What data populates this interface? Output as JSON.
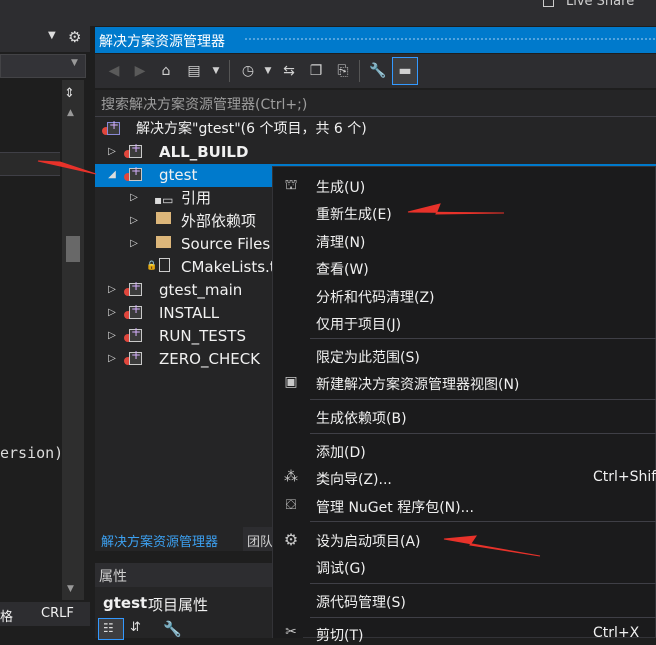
{
  "top": {
    "live_share": "Live Share"
  },
  "left": {
    "code_fragment": "ersion)",
    "status_left": "格",
    "status_crlf": "CRLF"
  },
  "solution_explorer": {
    "title": "解决方案资源管理器",
    "search_placeholder": "搜索解决方案资源管理器(Ctrl+;)",
    "tree": [
      {
        "id": "solution",
        "label": "解决方案\"gtest\"(6 个项目，共 6 个)"
      },
      {
        "id": "all_build",
        "label": "ALL_BUILD"
      },
      {
        "id": "gtest",
        "label": "gtest"
      },
      {
        "id": "references",
        "label": "引用"
      },
      {
        "id": "external_deps",
        "label": "外部依赖项"
      },
      {
        "id": "source_files",
        "label": "Source Files"
      },
      {
        "id": "cmakelists",
        "label": "CMakeLists.t"
      },
      {
        "id": "gtest_main",
        "label": "gtest_main"
      },
      {
        "id": "install",
        "label": "INSTALL"
      },
      {
        "id": "run_tests",
        "label": "RUN_TESTS"
      },
      {
        "id": "zero_check",
        "label": "ZERO_CHECK"
      }
    ],
    "tabs": {
      "active": "解决方案资源管理器",
      "other": "团队"
    }
  },
  "properties": {
    "title": "属性",
    "object_name": "gtest",
    "object_type": "项目属性"
  },
  "context_menu": {
    "items": [
      {
        "id": "build",
        "label": "生成(U)",
        "icon": "build-icon"
      },
      {
        "id": "rebuild",
        "label": "重新生成(E)"
      },
      {
        "id": "clean",
        "label": "清理(N)"
      },
      {
        "id": "view",
        "label": "查看(W)"
      },
      {
        "id": "analyze",
        "label": "分析和代码清理(Z)"
      },
      {
        "id": "project_only",
        "label": "仅用于项目(J)"
      },
      {
        "id": "scope_to_this",
        "label": "限定为此范围(S)"
      },
      {
        "id": "new_se_view",
        "label": "新建解决方案资源管理器视图(N)",
        "icon": "new-view-icon"
      },
      {
        "id": "build_deps",
        "label": "生成依赖项(B)"
      },
      {
        "id": "add",
        "label": "添加(D)"
      },
      {
        "id": "class_wizard",
        "label": "类向导(Z)...",
        "shortcut": "Ctrl+Shift",
        "icon": "class-wizard-icon"
      },
      {
        "id": "nuget",
        "label": "管理 NuGet 程序包(N)...",
        "icon": "nuget-icon"
      },
      {
        "id": "set_startup",
        "label": "设为启动项目(A)",
        "icon": "gear-icon"
      },
      {
        "id": "debug",
        "label": "调试(G)"
      },
      {
        "id": "source_control",
        "label": "源代码管理(S)"
      },
      {
        "id": "cut",
        "label": "剪切(T)",
        "shortcut": "Ctrl+X",
        "icon": "scissors-icon"
      }
    ]
  },
  "colors": {
    "accent": "#007acc",
    "annotation_arrow": "#e8322a",
    "menu_background": "#1b1b1c",
    "panel_background": "#252526"
  }
}
